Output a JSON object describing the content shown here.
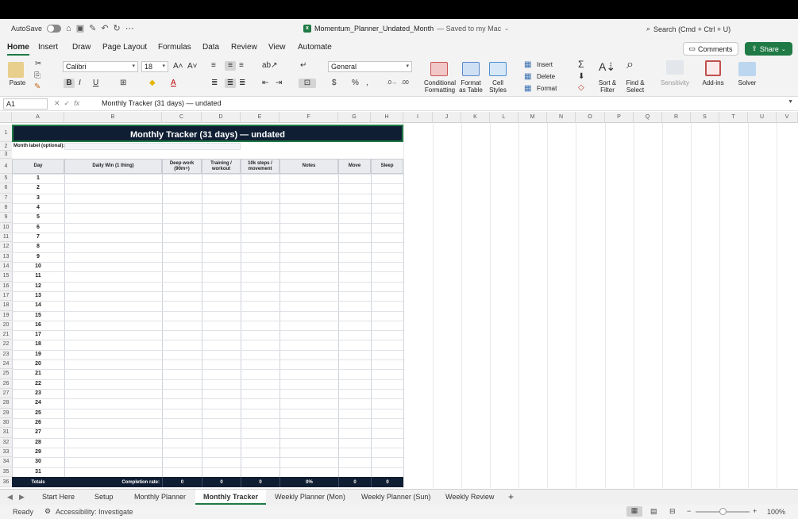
{
  "titlebar": {
    "autosave_label": "AutoSave",
    "filename": "Momentum_Planner_Undated_Month",
    "saved_status": "— Saved to my Mac",
    "search_placeholder": "Search (Cmd + Ctrl + U)"
  },
  "ribbon_tabs": [
    "Home",
    "Insert",
    "Draw",
    "Page Layout",
    "Formulas",
    "Data",
    "Review",
    "View",
    "Automate"
  ],
  "buttons": {
    "comments": "Comments",
    "share": "Share"
  },
  "ribbon": {
    "paste": "Paste",
    "font_name": "Calibri",
    "font_size": "18",
    "number_format": "General",
    "conditional_formatting": [
      "Conditional",
      "Formatting"
    ],
    "format_as_table": [
      "Format",
      "as Table"
    ],
    "cell_styles": [
      "Cell",
      "Styles"
    ],
    "insert": "Insert",
    "delete": "Delete",
    "format": "Format",
    "sort_filter": [
      "Sort &",
      "Filter"
    ],
    "find_select": [
      "Find &",
      "Select"
    ],
    "sensitivity": "Sensitivity",
    "addins": "Add-ins",
    "solver": "Solver"
  },
  "formula_bar": {
    "cell_ref": "A1",
    "fx": "fx",
    "content": "Monthly Tracker (31 days) — undated"
  },
  "columns": [
    "A",
    "B",
    "C",
    "D",
    "E",
    "F",
    "G",
    "H",
    "I",
    "J",
    "K",
    "L",
    "M",
    "N",
    "O",
    "P",
    "Q",
    "R",
    "S",
    "T",
    "U",
    "V"
  ],
  "sheet": {
    "title": "Monthly Tracker (31 days) — undated",
    "month_label": "Month label (optional):",
    "headers": [
      "Day",
      "Daily Win (1 thing)",
      "Deep work (90m+)",
      "Training / workout",
      "10k steps / movement",
      "Notes",
      "Move",
      "Sleep"
    ],
    "days": [
      "1",
      "2",
      "3",
      "4",
      "5",
      "6",
      "7",
      "8",
      "9",
      "10",
      "11",
      "12",
      "13",
      "14",
      "15",
      "16",
      "17",
      "18",
      "19",
      "20",
      "21",
      "22",
      "23",
      "24",
      "25",
      "26",
      "27",
      "28",
      "29",
      "30",
      "31"
    ],
    "totals_label": "Totals",
    "completion_label": "Completion rate:",
    "totals": [
      "0",
      "0",
      "0",
      "0%",
      "0",
      "0"
    ]
  },
  "sheet_tabs": [
    "Start Here",
    "Setup",
    "Monthly Planner",
    "Monthly Tracker",
    "Weekly Planner (Mon)",
    "Weekly Planner (Sun)",
    "Weekly Review"
  ],
  "status": {
    "ready": "Ready",
    "accessibility": "Accessibility: Investigate",
    "zoom": "100%"
  },
  "colors": {
    "excel_green": "#1f7a45",
    "title_navy": "#0f1e33"
  }
}
